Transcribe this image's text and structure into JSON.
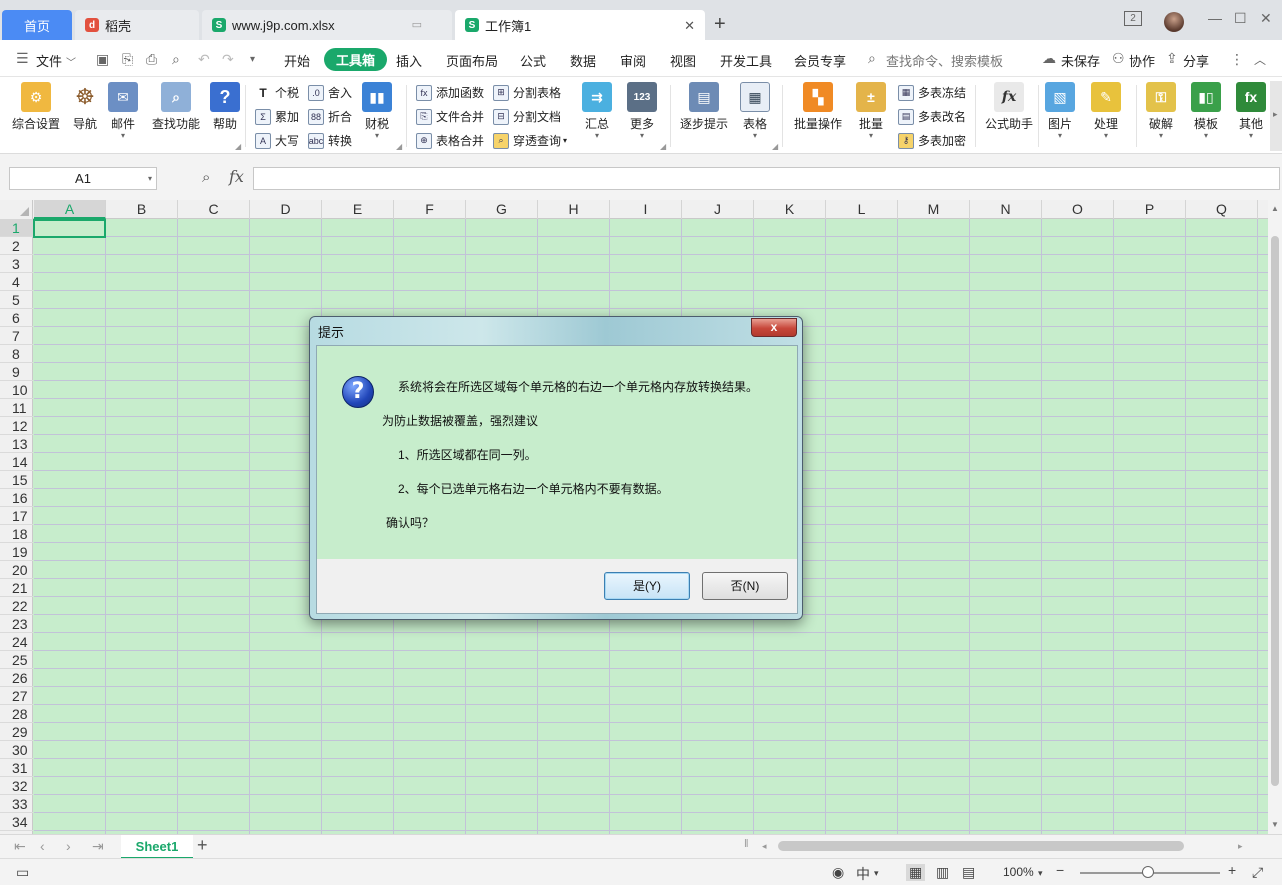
{
  "tabs": {
    "home": "首页",
    "daoke": "稻壳",
    "file1": "www.j9p.com.xlsx",
    "file2": "工作簿1",
    "new": "+",
    "window_count": "2"
  },
  "menu": {
    "file": "文件",
    "items": [
      "开始",
      "工具箱",
      "插入",
      "页面布局",
      "公式",
      "数据",
      "审阅",
      "视图",
      "开发工具",
      "会员专享"
    ],
    "search_placeholder": "查找命令、搜索模板",
    "unsaved": "未保存",
    "collab": "协作",
    "share": "分享"
  },
  "ribbon": {
    "settings": "综合设置",
    "nav": "导航",
    "mail": "邮件",
    "find": "查找功能",
    "help": "帮助",
    "tax": "个税",
    "round": "舍入",
    "sum": "累加",
    "discount": "折合",
    "upper": "大写",
    "convert": "转换",
    "finance": "财税",
    "addfunc": "添加函数",
    "splittable": "分割表格",
    "filemerge": "文件合并",
    "splitdoc": "分割文档",
    "tablemerge": "表格合并",
    "penetrate": "穿透查询",
    "summary": "汇总",
    "more": "更多",
    "step": "逐步提示",
    "table": "表格",
    "batchop": "批量操作",
    "batch": "批量",
    "freeze": "多表冻结",
    "rename": "多表改名",
    "encrypt": "多表加密",
    "formula": "公式助手",
    "picture": "图片",
    "process": "处理",
    "crack": "破解",
    "template": "模板",
    "other": "其他"
  },
  "formula_bar": {
    "cell": "A1",
    "fx": "fx",
    "value": ""
  },
  "sheet": {
    "columns": [
      "A",
      "B",
      "C",
      "D",
      "E",
      "F",
      "G",
      "H",
      "I",
      "J",
      "K",
      "L",
      "M",
      "N",
      "O",
      "P",
      "Q"
    ],
    "rows": [
      "1",
      "2",
      "3",
      "4",
      "5",
      "6",
      "7",
      "8",
      "9",
      "10",
      "11",
      "12",
      "13",
      "14",
      "15",
      "16",
      "17",
      "18",
      "19",
      "20",
      "21",
      "22",
      "23",
      "24",
      "25",
      "26",
      "27",
      "28",
      "29",
      "30",
      "31",
      "32",
      "33",
      "34"
    ],
    "tab": "Sheet1"
  },
  "status": {
    "zoom": "100%"
  },
  "dialog": {
    "title": "提示",
    "close": "x",
    "line1": "系统将会在所选区域每个单元格的右边一个单元格内存放转换结果。",
    "line2": "为防止数据被覆盖，强烈建议",
    "line3": "1、所选区域都在同一列。",
    "line4": "2、每个已选单元格右边一个单元格内不要有数据。",
    "line5": "确认吗？",
    "yes": "是(Y)",
    "no": "否(N)"
  },
  "colors": {
    "accent": "#1aa86b",
    "sheet_bg": "#c7edcc",
    "home_tab": "#4b8bf4"
  }
}
